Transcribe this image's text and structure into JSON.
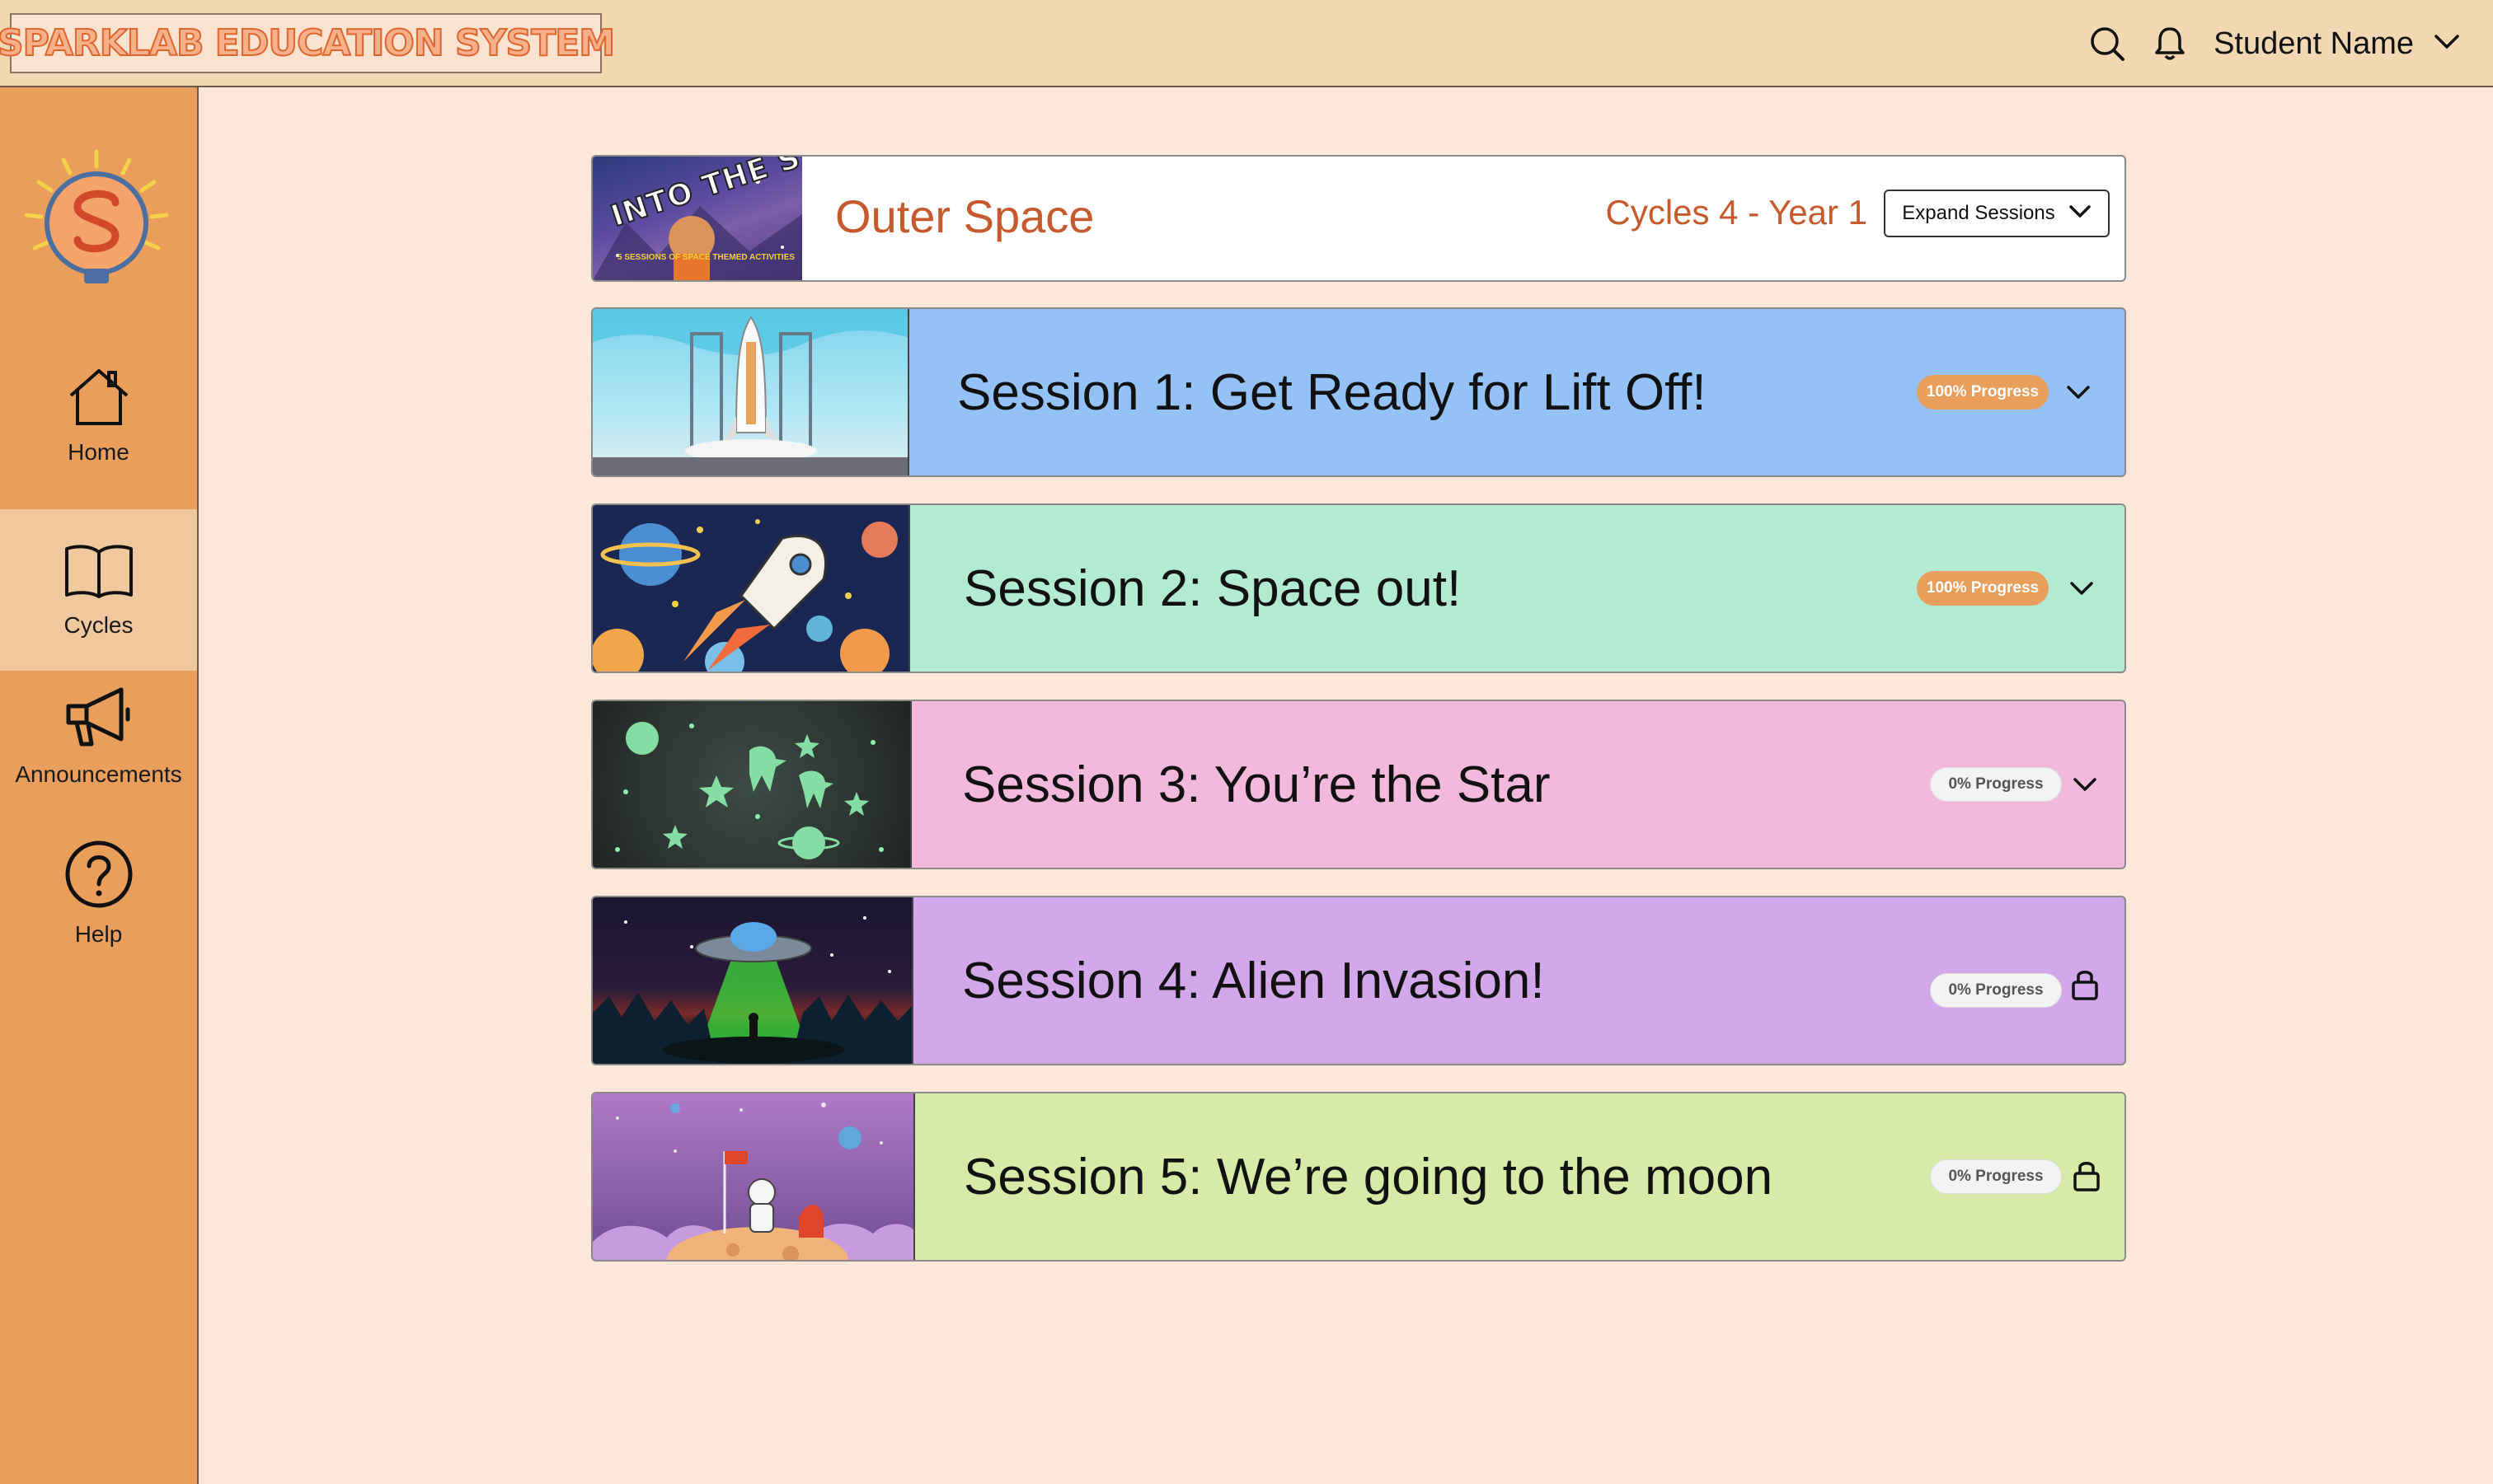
{
  "app": {
    "logo_text": "SPARKLAB EDUCATION SYSTEM"
  },
  "header": {
    "user_name": "Student Name",
    "icons": [
      "search-icon",
      "bell-icon",
      "chevron-down-icon"
    ]
  },
  "sidebar": {
    "items": [
      {
        "label": "Home",
        "icon": "home-icon",
        "active": false
      },
      {
        "label": "Cycles",
        "icon": "book-icon",
        "active": true
      },
      {
        "label": "Announcements",
        "icon": "megaphone-icon",
        "active": false
      },
      {
        "label": "Help",
        "icon": "help-icon",
        "active": false
      }
    ]
  },
  "course": {
    "thumb_title": "INTO THE SPACE",
    "thumb_subtitle": "5 SESSIONS OF SPACE THEMED ACTIVITIES",
    "title": "Outer Space",
    "cycle": "Cycles 4 - Year 1",
    "expand_label": "Expand Sessions"
  },
  "sessions": [
    {
      "title": "Session 1: Get Ready for Lift Off!",
      "progress": "100% Progress",
      "progress_value": 100,
      "state": "expandable",
      "color": "#94c2f7"
    },
    {
      "title": "Session 2: Space out!",
      "progress": "100% Progress",
      "progress_value": 100,
      "state": "expandable",
      "color": "#b2ead3"
    },
    {
      "title": "Session 3: You’re the Star",
      "progress": "0% Progress",
      "progress_value": 0,
      "state": "expandable",
      "color": "#f3b9dc"
    },
    {
      "title": "Session 4: Alien Invasion!",
      "progress": "0% Progress",
      "progress_value": 0,
      "state": "locked",
      "color": "#d2a8eb"
    },
    {
      "title": "Session 5: We’re going to the moon",
      "progress": "0% Progress",
      "progress_value": 0,
      "state": "locked",
      "color": "#d7eaa8"
    }
  ],
  "colors": {
    "page_bg": "#fde8da",
    "header_bg": "#f1d8b2",
    "sidebar_bg": "#ea9e5c",
    "sidebar_active": "#f0c89d",
    "accent_text": "#c65a2c"
  }
}
